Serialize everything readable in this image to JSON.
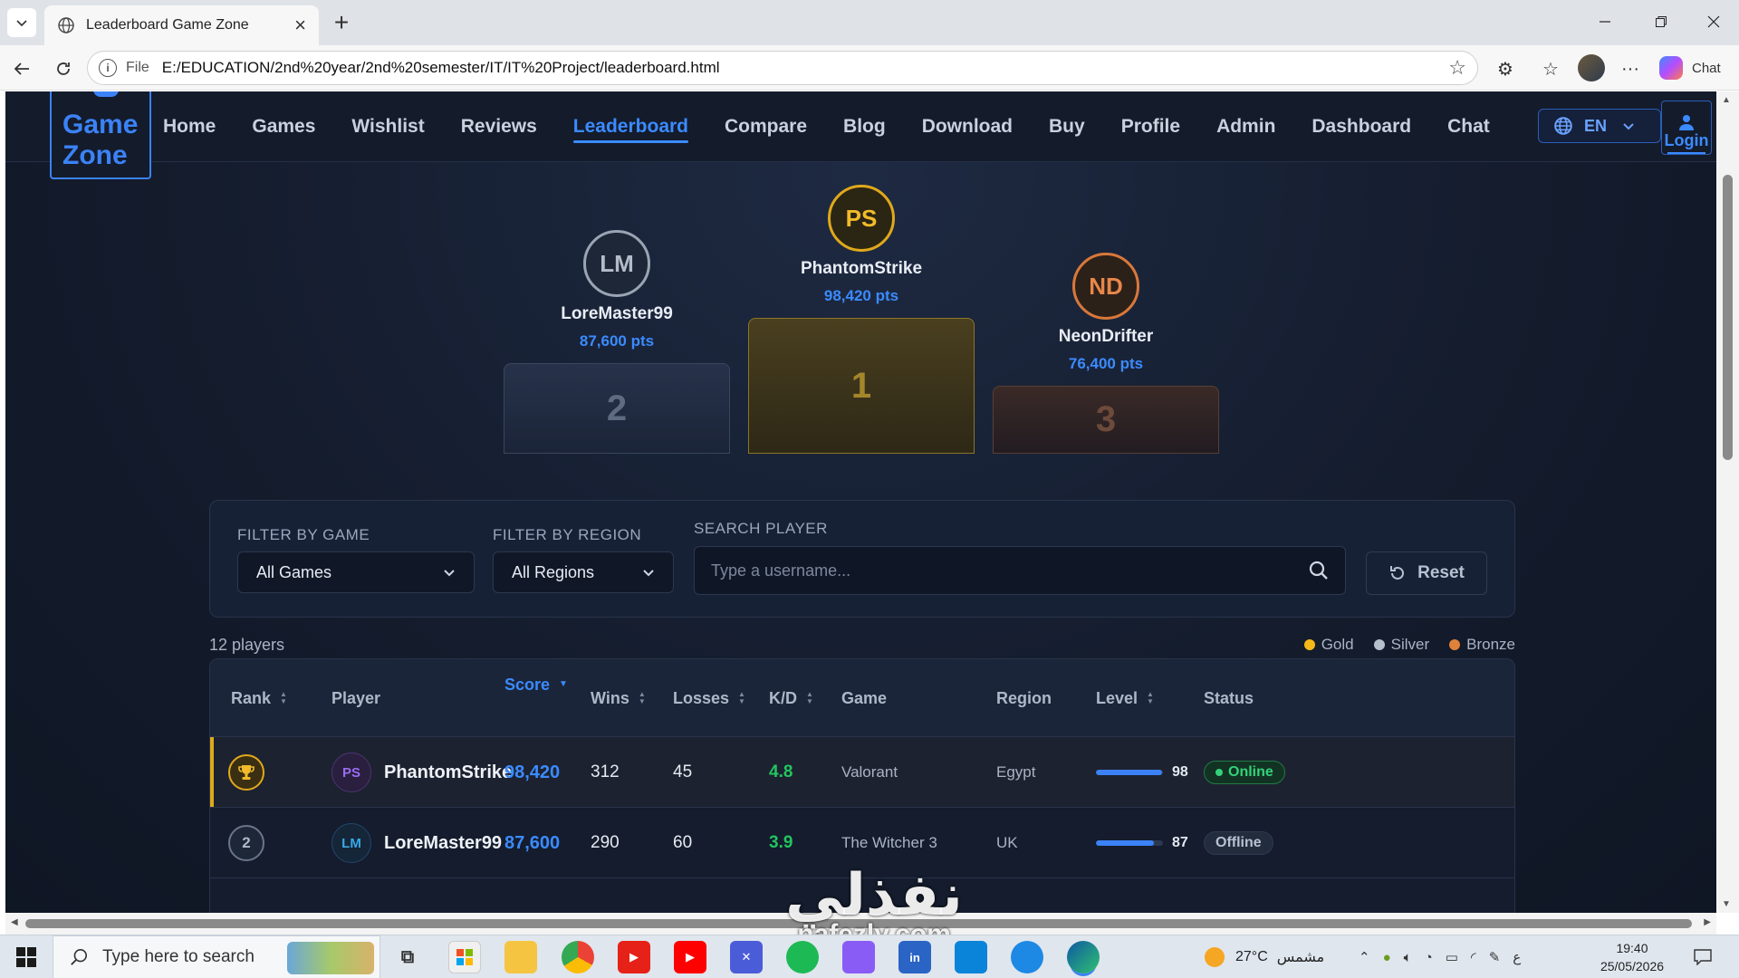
{
  "browser": {
    "tab_title": "Leaderboard Game Zone",
    "url_scheme": "File",
    "url": "E:/EDUCATION/2nd%20year/2nd%20semester/IT/IT%20Project/leaderboard.html",
    "chat_label": "Chat"
  },
  "site": {
    "brand_line1": "Game",
    "brand_line2": "Zone",
    "nav": [
      "Home",
      "Games",
      "Wishlist",
      "Reviews",
      "Leaderboard",
      "Compare",
      "Blog",
      "Download",
      "Buy",
      "Profile",
      "Admin",
      "Dashboard",
      "Chat"
    ],
    "active_nav": "Leaderboard",
    "lang_label": "EN",
    "login_label": "Login"
  },
  "podium": {
    "first": {
      "initials": "PS",
      "name": "PhantomStrike",
      "points": "98,420 pts",
      "place": "1"
    },
    "second": {
      "initials": "LM",
      "name": "LoreMaster99",
      "points": "87,600 pts",
      "place": "2"
    },
    "third": {
      "initials": "ND",
      "name": "NeonDrifter",
      "points": "76,400 pts",
      "place": "3"
    }
  },
  "filters": {
    "game_label": "FILTER BY GAME",
    "game_value": "All Games",
    "region_label": "FILTER BY REGION",
    "region_value": "All Regions",
    "search_label": "SEARCH PLAYER",
    "search_placeholder": "Type a username...",
    "reset_label": "Reset"
  },
  "summary": {
    "player_count": "12 players",
    "legend": [
      {
        "label": "Gold",
        "color": "#f5b819"
      },
      {
        "label": "Silver",
        "color": "#b6bfcc"
      },
      {
        "label": "Bronze",
        "color": "#e0823a"
      }
    ]
  },
  "table": {
    "columns": [
      "Rank",
      "Player",
      "Score",
      "Wins",
      "Losses",
      "K/D",
      "Game",
      "Region",
      "Level",
      "Status"
    ],
    "sorted_column": "Score",
    "rows": [
      {
        "rank": "",
        "initials": "PS",
        "player": "PhantomStrike",
        "score": "98,420",
        "wins": "312",
        "losses": "45",
        "kd": "4.8",
        "game": "Valorant",
        "region": "Egypt",
        "level": "98",
        "level_fraction": 0.98,
        "status": "Online"
      },
      {
        "rank": "2",
        "initials": "LM",
        "player": "LoreMaster99",
        "score": "87,600",
        "wins": "290",
        "losses": "60",
        "kd": "3.9",
        "game": "The Witcher 3",
        "region": "UK",
        "level": "87",
        "level_fraction": 0.87,
        "status": "Offline"
      }
    ]
  },
  "watermark": {
    "arabic": "نفذلي",
    "latin": "nafezly.com"
  },
  "taskbar": {
    "search_placeholder": "Type here to search",
    "weather": "27°C",
    "weather_desc": "مشمس",
    "lang_indicator": "ع",
    "time": "19:40",
    "date": "25/05/2026"
  },
  "colors": {
    "accent": "#3b8bff",
    "gold": "#e0a91b",
    "silver": "#9aa4b3",
    "bronze": "#d9783a",
    "online": "#34d27a"
  }
}
